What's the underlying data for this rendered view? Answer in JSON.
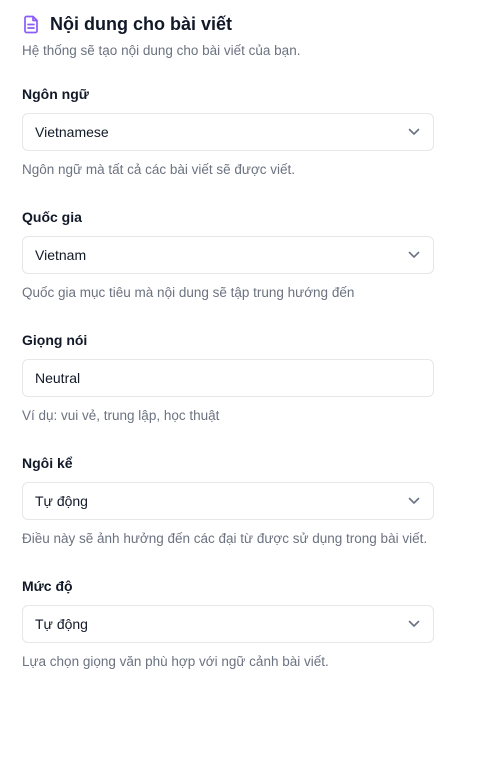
{
  "header": {
    "title": "Nội dung cho bài viết",
    "subtitle": "Hệ thống sẽ tạo nội dung cho bài viết của bạn.",
    "icon": "document-icon",
    "accent": "#8b5cf6"
  },
  "fields": [
    {
      "label": "Ngôn ngữ",
      "value": "Vietnamese",
      "type": "select",
      "help": "Ngôn ngữ mà tất cả các bài viết sẽ được viết."
    },
    {
      "label": "Quốc gia",
      "value": "Vietnam",
      "type": "select",
      "help": "Quốc gia mục tiêu mà nội dung sẽ tập trung hướng đến"
    },
    {
      "label": "Giọng nói",
      "value": "Neutral",
      "type": "text",
      "help": "Ví dụ: vui vẻ, trung lập, học thuật"
    },
    {
      "label": "Ngôi kể",
      "value": "Tự động",
      "type": "select",
      "help": "Điều này sẽ ảnh hưởng đến các đại từ được sử dụng trong bài viết."
    },
    {
      "label": "Mức độ",
      "value": "Tự động",
      "type": "select",
      "help": "Lựa chọn giọng văn phù hợp với ngữ cảnh bài viết."
    }
  ]
}
